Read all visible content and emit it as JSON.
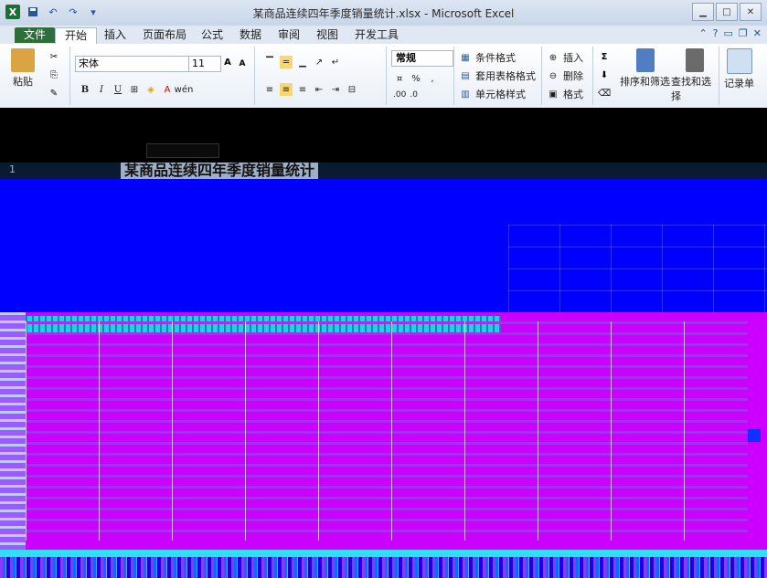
{
  "window": {
    "title": "某商品连续四年季度销量统计.xlsx - Microsoft Excel",
    "app_icon": "X",
    "controls": [
      "minimize-icon",
      "maximize-icon",
      "close-icon"
    ]
  },
  "quick_access": [
    "save-icon",
    "undo-icon",
    "redo-icon",
    "customize-icon"
  ],
  "tabs": {
    "file": "文件",
    "items": [
      "开始",
      "插入",
      "页面布局",
      "公式",
      "数据",
      "审阅",
      "视图",
      "开发工具"
    ],
    "active": "开始"
  },
  "ribbon": {
    "paste_label": "粘贴",
    "font_name": "宋体",
    "font_size": "11",
    "bold": "B",
    "italic": "I",
    "underline": "U",
    "increase_font": "A",
    "decrease_font": "A",
    "phonetic": "wén",
    "number_format": "常规",
    "percent": "%",
    "comma": ",",
    "dec_increase": ".00",
    "dec_decrease": ".0",
    "styles": {
      "conditional": "条件格式",
      "table_format": "套用表格格式",
      "cell_styles": "单元格样式"
    },
    "cells": {
      "insert": "插入",
      "delete": "删除",
      "format": "格式"
    },
    "editing": {
      "sum_icon": "Σ",
      "sort_filter": "排序和筛选",
      "find_select": "查找和选择"
    },
    "record": "记录单"
  },
  "sheet": {
    "row1_number": "1",
    "title": "某商品连续四年季度销量统计"
  },
  "colors": {
    "title_bar": "#d1dcea",
    "file_tab": "#2e6e3b",
    "artifact_blue": "#0000ff",
    "artifact_magenta": "#cc00ff",
    "artifact_cyan": "#1ad1f0"
  }
}
